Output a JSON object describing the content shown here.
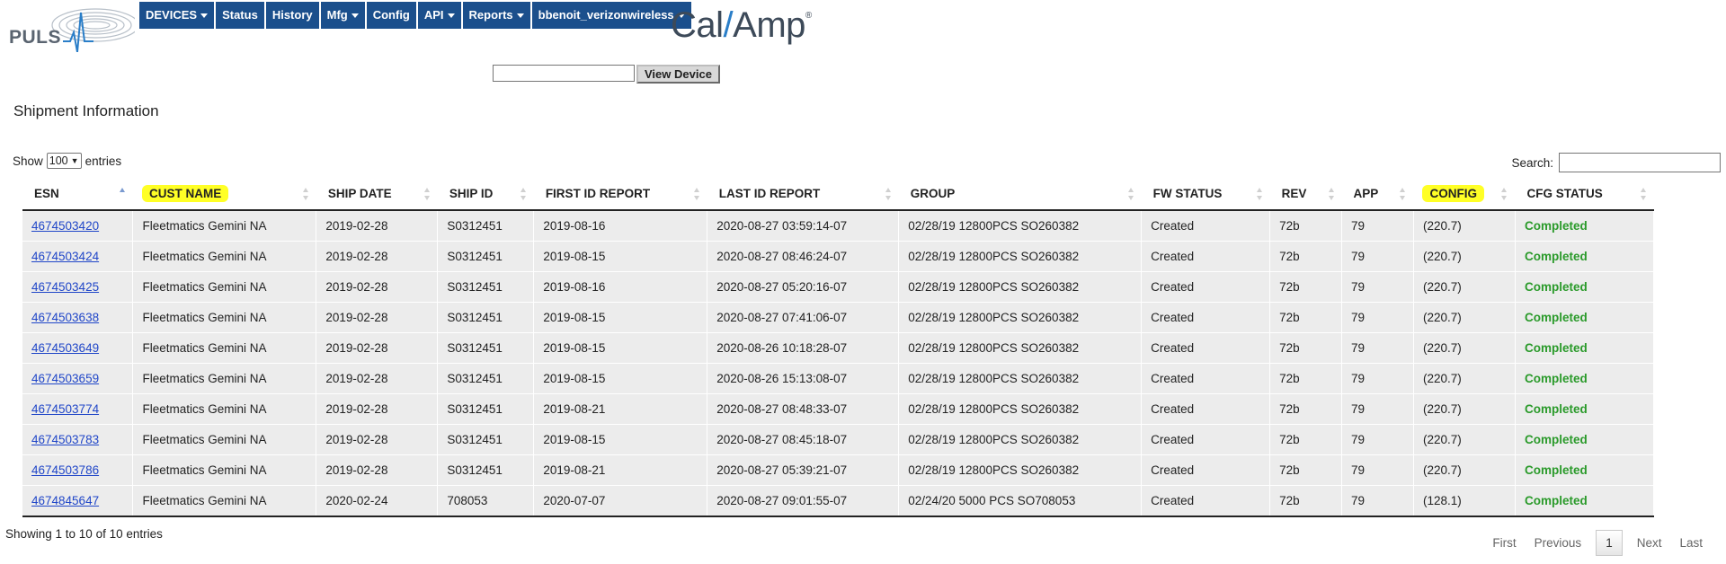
{
  "brand": {
    "puls": "PULS",
    "calamp": "Cal",
    "calamp_b": "Amp"
  },
  "nav": [
    {
      "label": "DEVICES",
      "dropdown": true
    },
    {
      "label": "Status",
      "dropdown": false
    },
    {
      "label": "History",
      "dropdown": false
    },
    {
      "label": "Mfg",
      "dropdown": true
    },
    {
      "label": "Config",
      "dropdown": false
    },
    {
      "label": "API",
      "dropdown": true
    },
    {
      "label": "Reports",
      "dropdown": true
    },
    {
      "label": "bbenoit_verizonwireless",
      "dropdown": true
    }
  ],
  "device_lookup": {
    "value": "",
    "button": "View Device"
  },
  "section_title": "Shipment Information",
  "length_control": {
    "show": "Show",
    "selected": "100",
    "entries": "entries"
  },
  "search": {
    "label": "Search:",
    "value": ""
  },
  "table": {
    "columns": [
      {
        "label": "ESN",
        "highlight": false,
        "sort": "asc"
      },
      {
        "label": "CUST NAME",
        "highlight": true,
        "sort": "none"
      },
      {
        "label": "SHIP DATE",
        "highlight": false,
        "sort": "none"
      },
      {
        "label": "SHIP ID",
        "highlight": false,
        "sort": "none"
      },
      {
        "label": "FIRST ID REPORT",
        "highlight": false,
        "sort": "none"
      },
      {
        "label": "LAST ID REPORT",
        "highlight": false,
        "sort": "none"
      },
      {
        "label": "GROUP",
        "highlight": false,
        "sort": "none"
      },
      {
        "label": "FW STATUS",
        "highlight": false,
        "sort": "none"
      },
      {
        "label": "REV",
        "highlight": false,
        "sort": "none"
      },
      {
        "label": "APP",
        "highlight": false,
        "sort": "none"
      },
      {
        "label": "CONFIG",
        "highlight": true,
        "sort": "none"
      },
      {
        "label": "CFG STATUS",
        "highlight": false,
        "sort": "none"
      }
    ],
    "rows": [
      [
        "4674503420",
        "Fleetmatics Gemini NA",
        "2019-02-28",
        "S0312451",
        "2019-08-16",
        "2020-08-27 03:59:14-07",
        "02/28/19 12800PCS SO260382",
        "Created",
        "72b",
        "79",
        "(220.7)",
        "Completed"
      ],
      [
        "4674503424",
        "Fleetmatics Gemini NA",
        "2019-02-28",
        "S0312451",
        "2019-08-15",
        "2020-08-27 08:46:24-07",
        "02/28/19 12800PCS SO260382",
        "Created",
        "72b",
        "79",
        "(220.7)",
        "Completed"
      ],
      [
        "4674503425",
        "Fleetmatics Gemini NA",
        "2019-02-28",
        "S0312451",
        "2019-08-16",
        "2020-08-27 05:20:16-07",
        "02/28/19 12800PCS SO260382",
        "Created",
        "72b",
        "79",
        "(220.7)",
        "Completed"
      ],
      [
        "4674503638",
        "Fleetmatics Gemini NA",
        "2019-02-28",
        "S0312451",
        "2019-08-15",
        "2020-08-27 07:41:06-07",
        "02/28/19 12800PCS SO260382",
        "Created",
        "72b",
        "79",
        "(220.7)",
        "Completed"
      ],
      [
        "4674503649",
        "Fleetmatics Gemini NA",
        "2019-02-28",
        "S0312451",
        "2019-08-15",
        "2020-08-26 10:18:28-07",
        "02/28/19 12800PCS SO260382",
        "Created",
        "72b",
        "79",
        "(220.7)",
        "Completed"
      ],
      [
        "4674503659",
        "Fleetmatics Gemini NA",
        "2019-02-28",
        "S0312451",
        "2019-08-15",
        "2020-08-26 15:13:08-07",
        "02/28/19 12800PCS SO260382",
        "Created",
        "72b",
        "79",
        "(220.7)",
        "Completed"
      ],
      [
        "4674503774",
        "Fleetmatics Gemini NA",
        "2019-02-28",
        "S0312451",
        "2019-08-21",
        "2020-08-27 08:48:33-07",
        "02/28/19 12800PCS SO260382",
        "Created",
        "72b",
        "79",
        "(220.7)",
        "Completed"
      ],
      [
        "4674503783",
        "Fleetmatics Gemini NA",
        "2019-02-28",
        "S0312451",
        "2019-08-15",
        "2020-08-27 08:45:18-07",
        "02/28/19 12800PCS SO260382",
        "Created",
        "72b",
        "79",
        "(220.7)",
        "Completed"
      ],
      [
        "4674503786",
        "Fleetmatics Gemini NA",
        "2019-02-28",
        "S0312451",
        "2019-08-21",
        "2020-08-27 05:39:21-07",
        "02/28/19 12800PCS SO260382",
        "Created",
        "72b",
        "79",
        "(220.7)",
        "Completed"
      ],
      [
        "4674845647",
        "Fleetmatics Gemini NA",
        "2020-02-24",
        "708053",
        "2020-07-07",
        "2020-08-27 09:01:55-07",
        "02/24/20 5000 PCS SO708053",
        "Created",
        "72b",
        "79",
        "(128.1)",
        "Completed"
      ]
    ]
  },
  "info": "Showing 1 to 10 of 10 entries",
  "pagination": {
    "first": "First",
    "previous": "Previous",
    "current": "1",
    "next": "Next",
    "last": "Last"
  },
  "colors": {
    "nav_bg": "#1b4f8c",
    "highlight": "#ffff26",
    "link": "#2046c8",
    "completed": "#2a9a2a",
    "row_bg": "#ececec"
  }
}
